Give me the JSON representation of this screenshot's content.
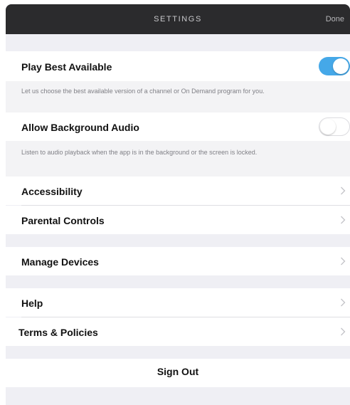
{
  "header": {
    "title": "SETTINGS",
    "done_label": "Done"
  },
  "settings": {
    "play_best_available": {
      "label": "Play Best Available",
      "description": "Let us choose the best available version of a channel or On Demand program for you.",
      "enabled": true
    },
    "allow_background_audio": {
      "label": "Allow Background Audio",
      "description": "Listen to audio playback when the app is in the background or the screen is locked.",
      "enabled": false
    }
  },
  "menu": {
    "accessibility": "Accessibility",
    "parental_controls": "Parental Controls",
    "manage_devices": "Manage Devices",
    "help": "Help",
    "terms_policies": "Terms & Policies"
  },
  "sign_out_label": "Sign Out",
  "colors": {
    "accent": "#45a8e8",
    "navbar": "#2b2b2d",
    "background": "#efeff4"
  },
  "icons": {
    "row_disclosure": "chevron-right-icon"
  }
}
